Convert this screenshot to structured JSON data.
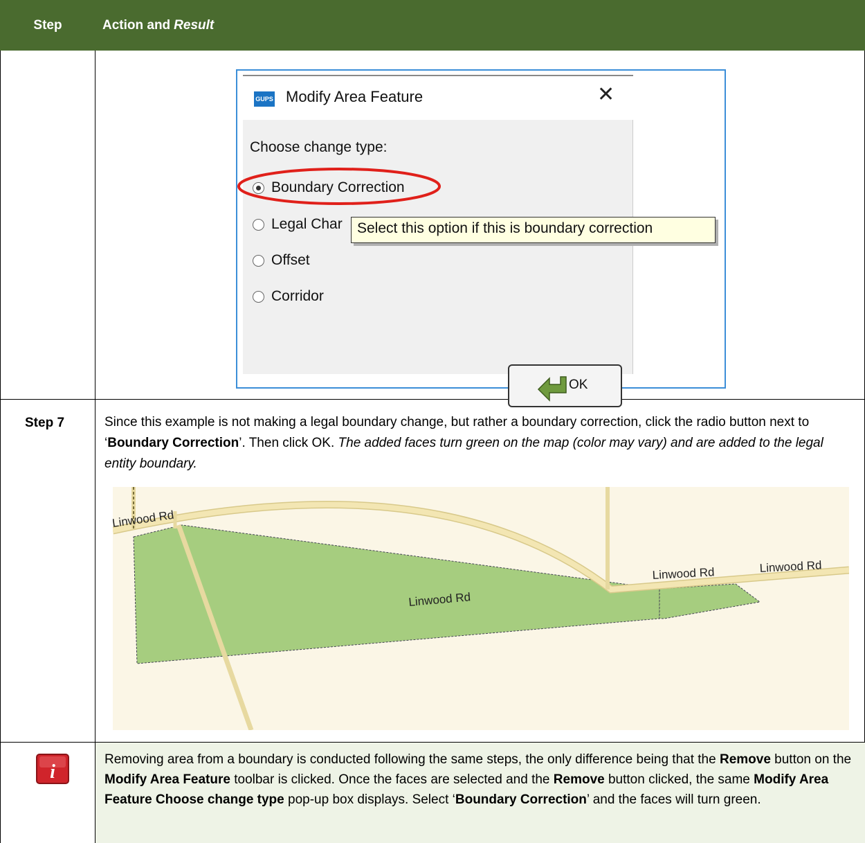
{
  "header": {
    "step_col": "Step",
    "action_col_prefix": "Action and",
    "action_col_italic": "Result"
  },
  "dialog": {
    "icon_text": "GUPS",
    "title": "Modify Area Feature",
    "close": "✕",
    "prompt": "Choose change type:",
    "options": [
      {
        "label": "Boundary Correction",
        "selected": true
      },
      {
        "label": "Legal Char",
        "selected": false
      },
      {
        "label": "Offset",
        "selected": false
      },
      {
        "label": "Corridor",
        "selected": false
      }
    ],
    "ok_label": "OK",
    "tooltip": "Select this option if this is boundary correction",
    "highlight_color": "#e0201a"
  },
  "step7": {
    "label": "Step 7",
    "text_1": "Since this example is not making a legal boundary change, but rather a boundary correction, click the radio button next to ‘",
    "text_bold": "Boundary Correction",
    "text_2": "’. Then click OK. ",
    "text_italic": "The added faces turn green on the map (color may vary) and are added to the legal entity boundary."
  },
  "map": {
    "road_labels": [
      "Linwood Rd",
      "Linwood Rd",
      "Linwood Rd",
      "Linwood Rd"
    ],
    "face_color": "#a6cd7f",
    "road_color": "#f3e6b3",
    "background_color": "#fbf6e6"
  },
  "note": {
    "p1": "Removing area from a boundary is conducted following the same steps, the only difference being that the ",
    "b1": "Remove",
    "p2": " button on the ",
    "b2": "Modify Area Feature",
    "p3": " toolbar is clicked. Once the faces are selected and the ",
    "b3": "Remove",
    "p4": " button clicked, the same ",
    "b4": "Modify Area Feature Choose change type",
    "p5": " pop-up box displays. Select ‘",
    "b5": "Boundary Correction",
    "p6": "’ and the faces will turn green."
  }
}
